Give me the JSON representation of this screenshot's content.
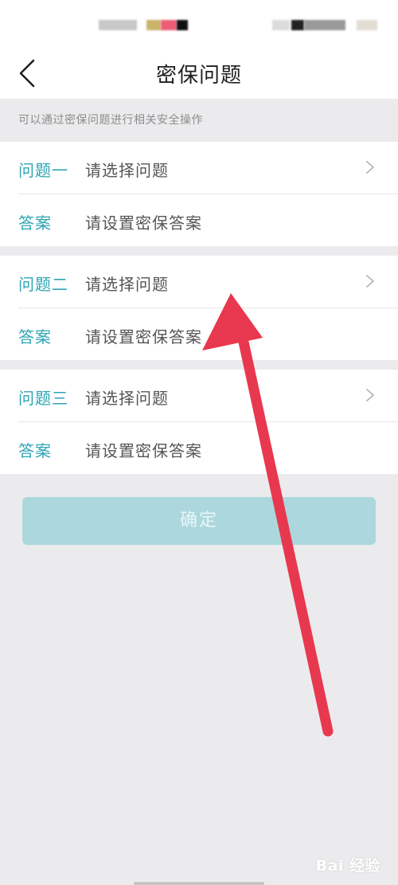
{
  "nav": {
    "title": "密保问题"
  },
  "hint": "可以通过密保问题进行相关安全操作",
  "groups": [
    {
      "question_label": "问题一",
      "question_placeholder": "请选择问题",
      "answer_label": "答案",
      "answer_placeholder": "请设置密保答案"
    },
    {
      "question_label": "问题二",
      "question_placeholder": "请选择问题",
      "answer_label": "答案",
      "answer_placeholder": "请设置密保答案"
    },
    {
      "question_label": "问题三",
      "question_placeholder": "请选择问题",
      "answer_label": "答案",
      "answer_placeholder": "请设置密保答案"
    }
  ],
  "confirm_label": "确定",
  "watermark": "Bai  经验",
  "colors": {
    "accent": "#2ea4b4",
    "button_disabled": "#acd8dd",
    "annotation_arrow": "#e8384f",
    "background": "#ebebed"
  },
  "icons": {
    "back": "chevron-left-icon",
    "row_chevron": "chevron-right-icon"
  }
}
